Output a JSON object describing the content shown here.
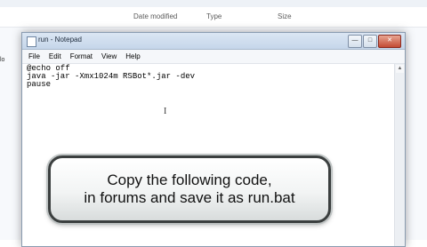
{
  "explorer": {
    "columns": {
      "date": "Date modified",
      "type": "Type",
      "size": "Size"
    },
    "left_text": "lo"
  },
  "notepad": {
    "title": "run - Notepad",
    "menu": [
      "File",
      "Edit",
      "Format",
      "View",
      "Help"
    ],
    "lines": [
      "@echo off",
      "java -jar -Xmx1024m RSBot*.jar -dev",
      "pause"
    ]
  },
  "caption": {
    "line1": "Copy the following code,",
    "line2": "in forums and save it as run.bat"
  }
}
